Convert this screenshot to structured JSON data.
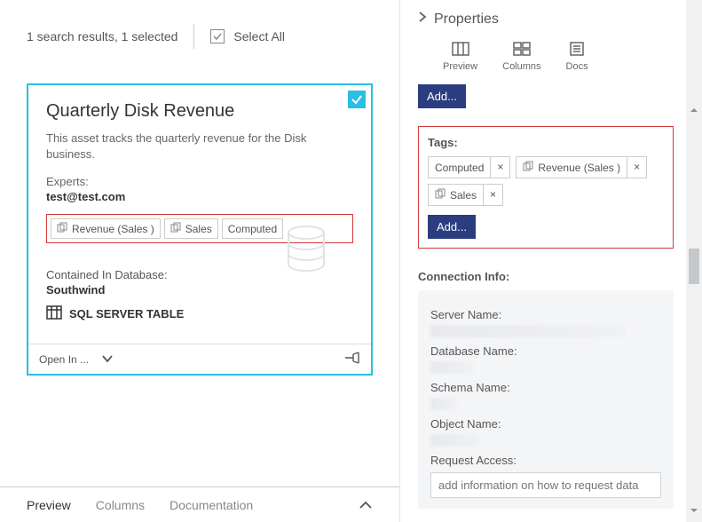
{
  "topbar": {
    "results_text": "1 search results, 1 selected",
    "select_all_label": "Select All"
  },
  "card": {
    "title": "Quarterly Disk Revenue",
    "description": "This asset tracks the quarterly revenue for the Disk business.",
    "experts_label": "Experts:",
    "experts_value": "test@test.com",
    "tags": [
      "Revenue (Sales )",
      "Sales",
      "Computed"
    ],
    "contained_label": "Contained In Database:",
    "contained_value": "Southwind",
    "asset_type": "SQL SERVER TABLE",
    "footer": {
      "open_in": "Open In ..."
    }
  },
  "bottom_tabs": {
    "items": [
      "Preview",
      "Columns",
      "Documentation"
    ],
    "active": "Preview"
  },
  "properties": {
    "header": "Properties",
    "icons": [
      {
        "name": "Preview"
      },
      {
        "name": "Columns"
      },
      {
        "name": "Docs"
      }
    ],
    "add_label": "Add...",
    "tags_label": "Tags:",
    "tags": [
      "Computed",
      "Revenue (Sales )",
      "Sales"
    ],
    "tags_add_label": "Add...",
    "connection_label": "Connection Info:",
    "conn_fields": {
      "server": "Server Name:",
      "database": "Database Name:",
      "schema": "Schema Name:",
      "object": "Object Name:",
      "request": "Request Access:"
    },
    "request_placeholder": "add information on how to request data"
  }
}
